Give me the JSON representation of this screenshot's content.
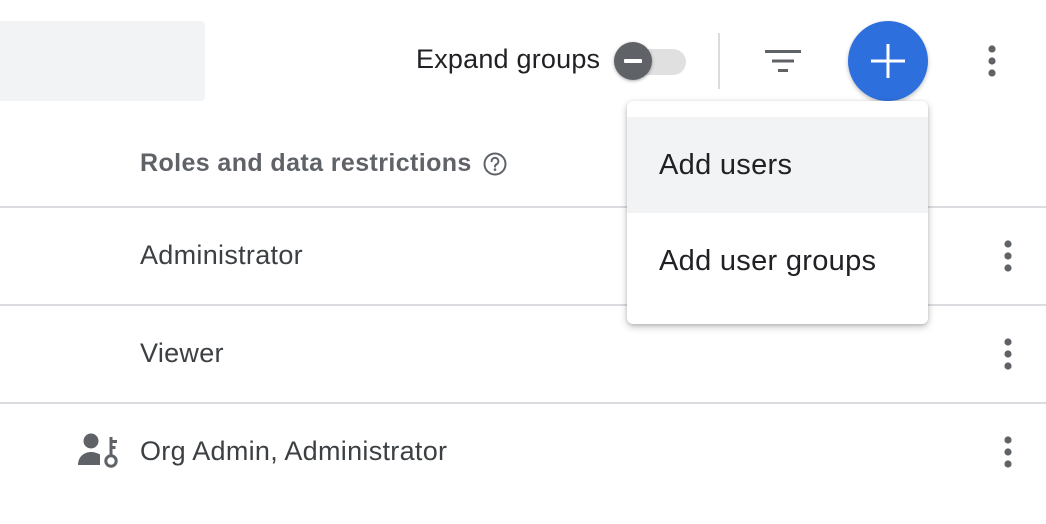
{
  "toolbar": {
    "expand_label": "Expand groups",
    "expand_toggle_on": false,
    "filter_icon": "filter-icon",
    "add_icon": "add-icon",
    "more_icon": "more-vert-icon",
    "accent_color": "#2d6fdd"
  },
  "table": {
    "column_header": "Roles and data restrictions",
    "column_header_icon": "help-icon",
    "rows": [
      {
        "roles": "Administrator",
        "icon": ""
      },
      {
        "roles": "Viewer",
        "icon": ""
      },
      {
        "roles": "Org Admin, Administrator",
        "icon": "person-key-icon"
      }
    ]
  },
  "add_menu": {
    "items": [
      {
        "label": "Add users",
        "highlighted": true
      },
      {
        "label": "Add user groups",
        "highlighted": false
      }
    ]
  }
}
